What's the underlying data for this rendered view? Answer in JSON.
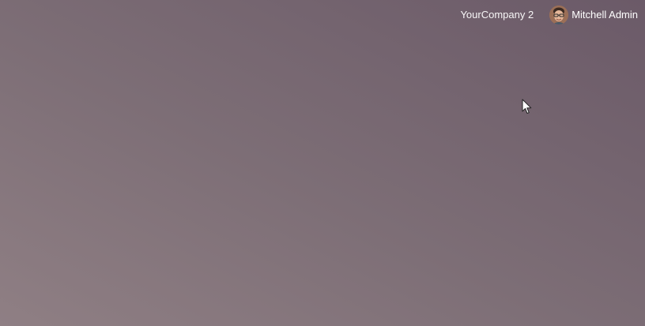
{
  "topbar": {
    "company_name": "YourCompany 2",
    "user_name": "Mitchell Admin",
    "user_avatar_icon": "user-avatar-icon"
  },
  "colors": {
    "background_top_right": "#6b5a68",
    "background_bottom_left": "#8f7f84",
    "topbar_text": "#ffffff"
  },
  "pointer": {
    "icon": "mouse-pointer-icon"
  }
}
